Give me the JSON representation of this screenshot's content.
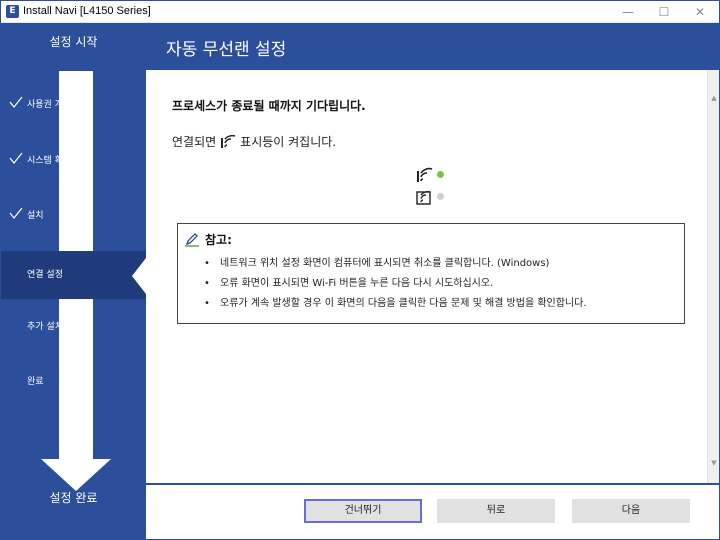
{
  "window": {
    "title": "Install Navi [L4150 Series]",
    "icon": "app-icon",
    "controls": {
      "minimize": "—",
      "maximize": "☐",
      "close": "✕"
    }
  },
  "sidebar": {
    "start_label": "설정 시작",
    "end_label": "설정 완료",
    "steps": [
      {
        "label": "사용권 계약",
        "done": true,
        "active": false
      },
      {
        "label": "시스템 확인",
        "done": true,
        "active": false
      },
      {
        "label": "설치",
        "done": true,
        "active": false
      },
      {
        "label": "연결 설정",
        "done": false,
        "active": true
      },
      {
        "label": "추가 설치",
        "done": false,
        "active": false
      },
      {
        "label": "완료",
        "done": false,
        "active": false
      }
    ]
  },
  "header": {
    "title": "자동 무선랜 설정"
  },
  "main": {
    "heading": "프로세스가 종료될 때까지 기다립니다.",
    "sub_before": "연결되면",
    "sub_after": "표시등이 켜집니다.",
    "lamps": [
      {
        "icon": "wifi-lamp-icon",
        "status_color": "#7cc142"
      },
      {
        "icon": "wifi-direct-lamp-icon",
        "status_color": "#cfcfcf"
      }
    ],
    "note": {
      "title": "참고:",
      "items": [
        "네트워크 위치 설정 화면이 컴퓨터에 표시되면 취소를 클릭합니다. (Windows)",
        "오류 화면이 표시되면 Wi-Fi 버튼을 누른 다음 다시 시도하십시오.",
        "오류가 계속 발생할 경우 이 화면의 다음을 클릭한 다음 문제 및 해결 방법을 확인합니다."
      ]
    }
  },
  "footer": {
    "skip_label": "건너뛰기",
    "back_label": "뒤로",
    "next_label": "다음"
  },
  "colors": {
    "brand": "#2b4f9a",
    "active_step": "#1f3b7b",
    "lamp_on": "#7cc142",
    "lamp_off": "#cfcfcf"
  }
}
